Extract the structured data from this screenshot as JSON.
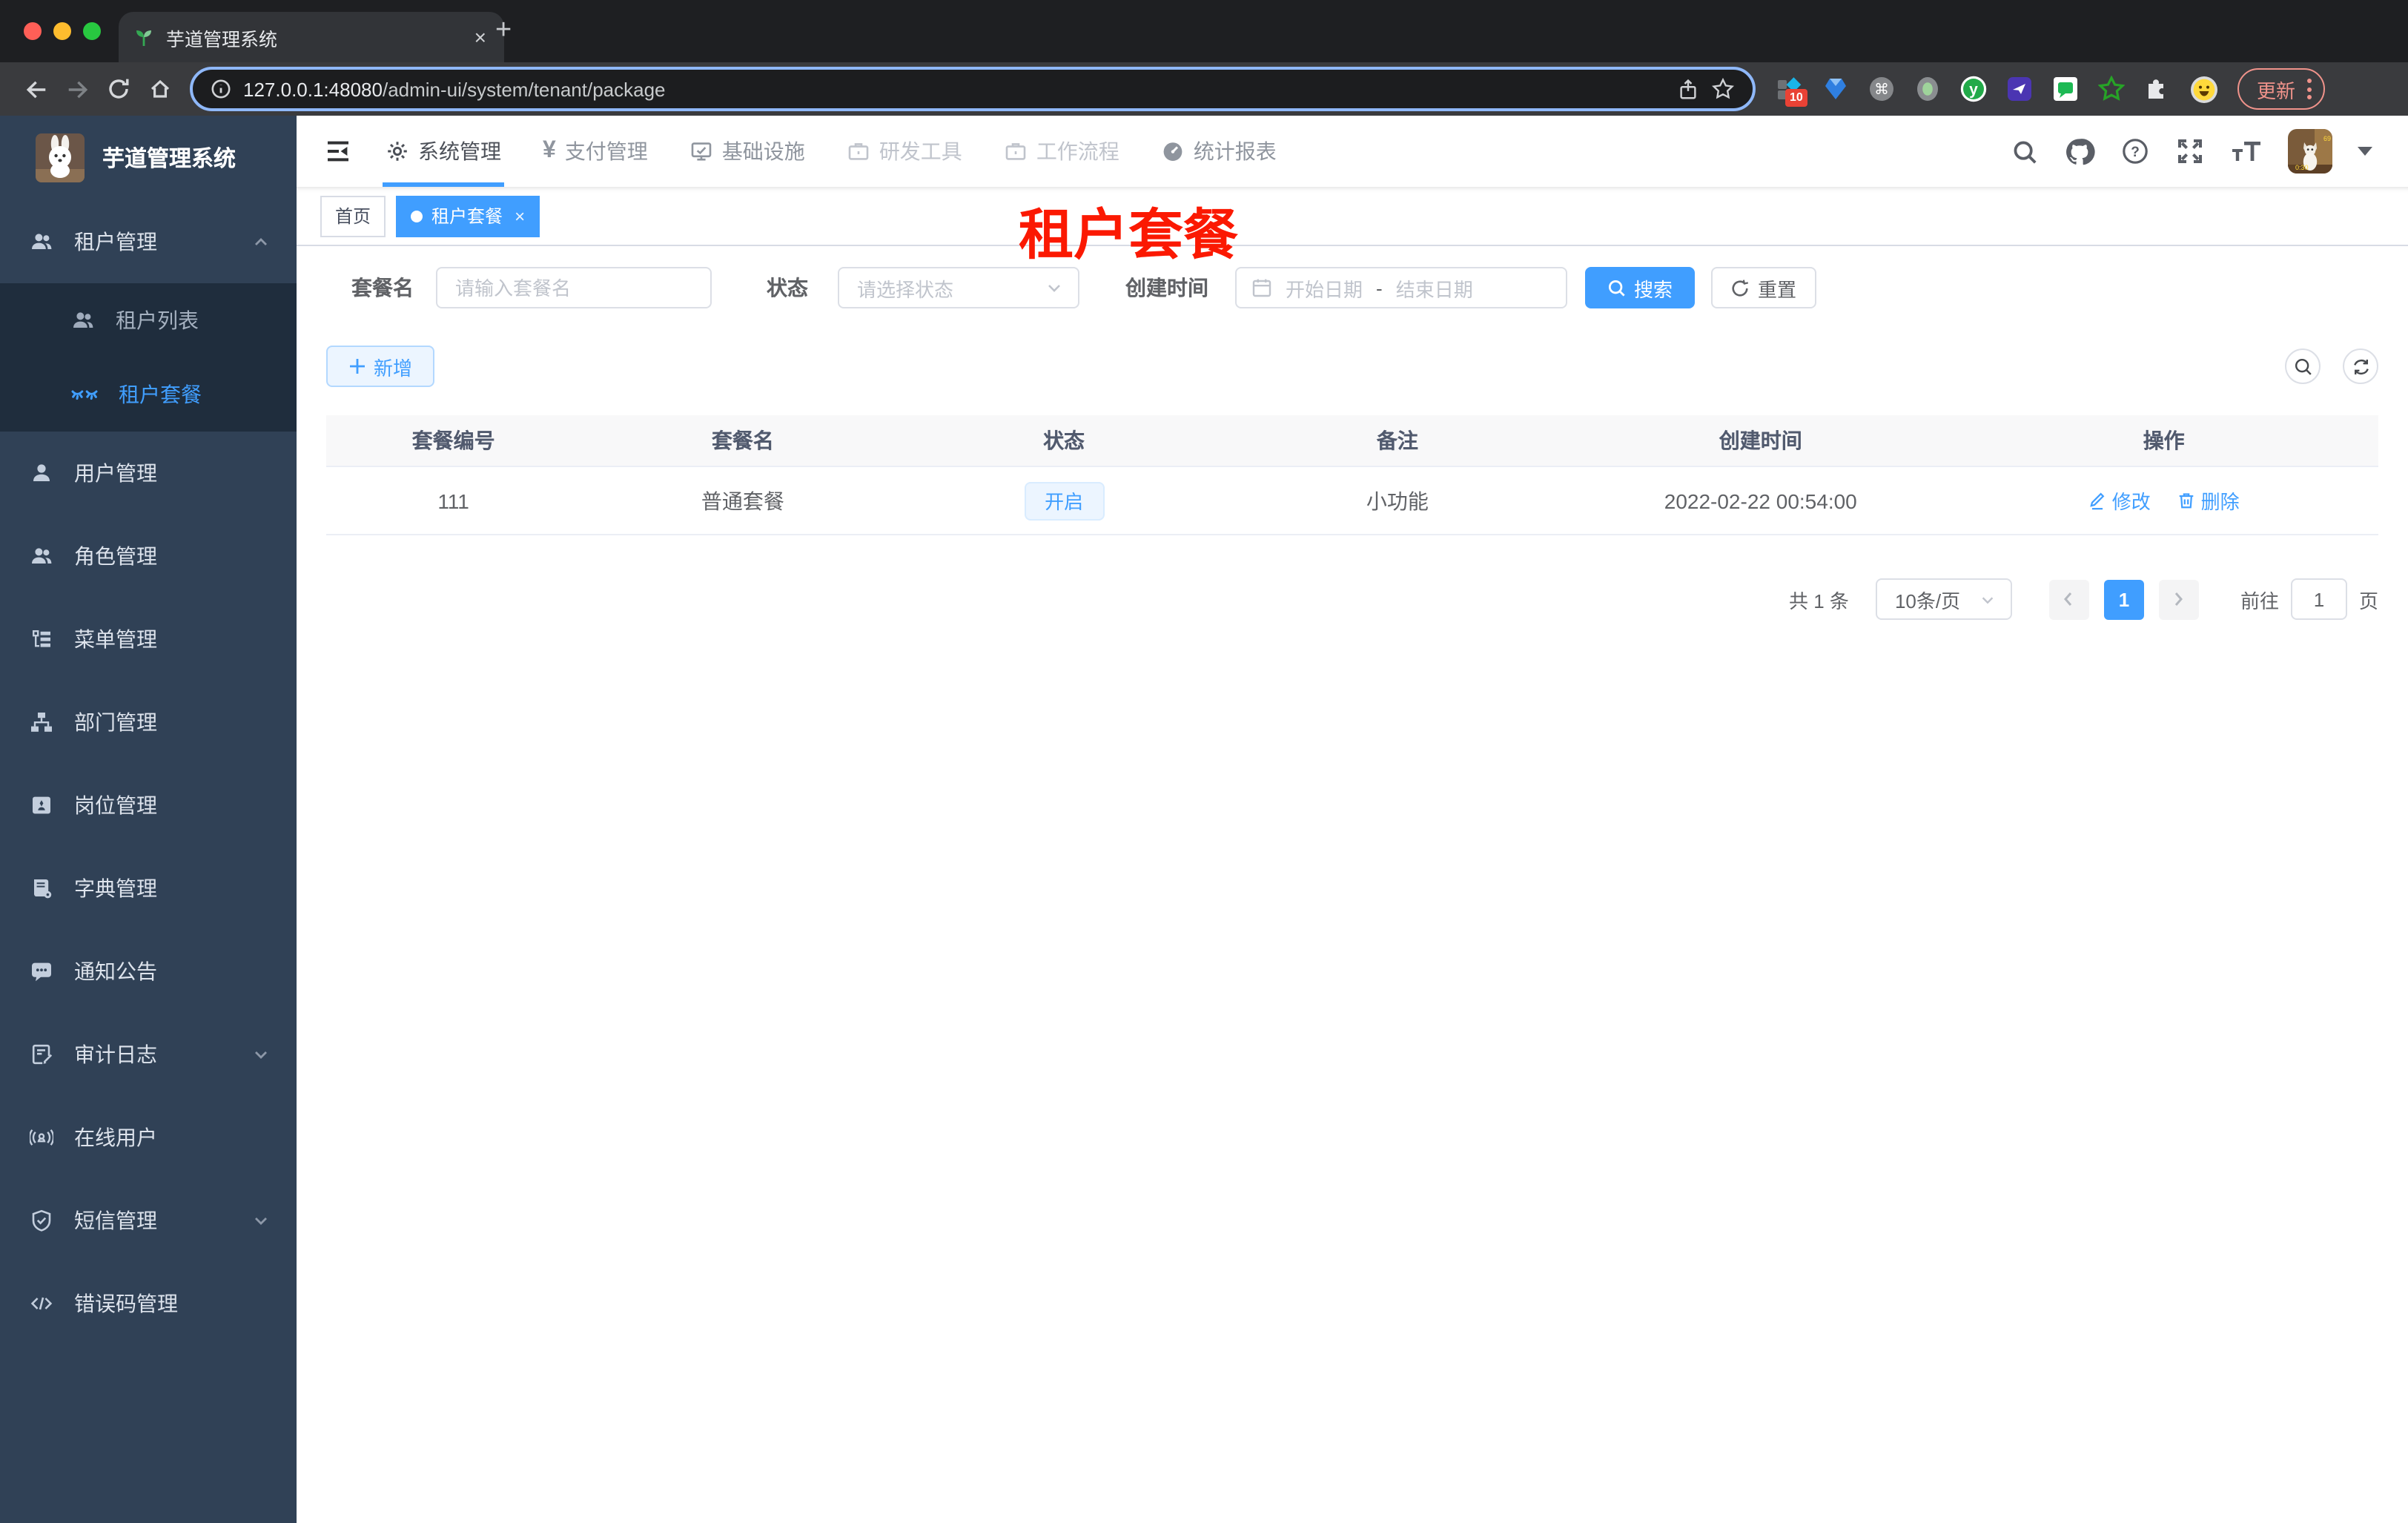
{
  "colors": {
    "accent": "#409eff",
    "red-title": "#fb1902",
    "sidebar-bg": "#304156",
    "sidebar-sub-bg": "#1f2d3d",
    "sidebar-text": "#bfcbd9",
    "chrome-tabstrip": "#1e1f22",
    "chrome-toolbar": "#3a3b3e",
    "update-red": "#f0938b",
    "tag-border": "#d8dce5",
    "table-header-bg": "#f8f8f9"
  },
  "browser": {
    "tab": {
      "title": "芋道管理系统",
      "close": "×",
      "new_tab": "+"
    },
    "url_host": "127.0.0.1:48080",
    "url_path": "/admin-ui/system/tenant/package",
    "extension_badge": "10",
    "update_button": "更新"
  },
  "sidebar": {
    "app_title": "芋道管理系统",
    "items": [
      {
        "label": "租户管理"
      },
      {
        "label": "租户列表"
      },
      {
        "label": "租户套餐"
      },
      {
        "label": "用户管理"
      },
      {
        "label": "角色管理"
      },
      {
        "label": "菜单管理"
      },
      {
        "label": "部门管理"
      },
      {
        "label": "岗位管理"
      },
      {
        "label": "字典管理"
      },
      {
        "label": "通知公告"
      },
      {
        "label": "审计日志"
      },
      {
        "label": "在线用户"
      },
      {
        "label": "短信管理"
      },
      {
        "label": "错误码管理"
      }
    ]
  },
  "topnav": {
    "items": [
      {
        "label": "系统管理"
      },
      {
        "label": "支付管理"
      },
      {
        "label": "基础设施"
      },
      {
        "label": "研发工具"
      },
      {
        "label": "工作流程"
      },
      {
        "label": "统计报表"
      }
    ],
    "yen_glyph": "¥"
  },
  "tags_view": {
    "home": "首页",
    "active_tab": "租户套餐",
    "close": "×"
  },
  "overlay_title": "租户套餐",
  "filters": {
    "name_label": "套餐名",
    "name_placeholder": "请输入套餐名",
    "status_label": "状态",
    "status_placeholder": "请选择状态",
    "date_label": "创建时间",
    "date_start_placeholder": "开始日期",
    "date_separator": "-",
    "date_end_placeholder": "结束日期",
    "search_button": "搜索",
    "reset_button": "重置"
  },
  "toolbar": {
    "add_button": "新增"
  },
  "table": {
    "headers": [
      "套餐编号",
      "套餐名",
      "状态",
      "备注",
      "创建时间",
      "操作"
    ],
    "rows": [
      {
        "id": "111",
        "name": "普通套餐",
        "status": "开启",
        "remark": "小功能",
        "created_at": "2022-02-22 00:54:00",
        "edit": "修改",
        "delete": "删除"
      }
    ]
  },
  "pagination": {
    "total": "共 1 条",
    "page_size": "10条/页",
    "current_page": "1",
    "goto_label": "前往",
    "goto_value": "1",
    "page_unit": "页"
  }
}
